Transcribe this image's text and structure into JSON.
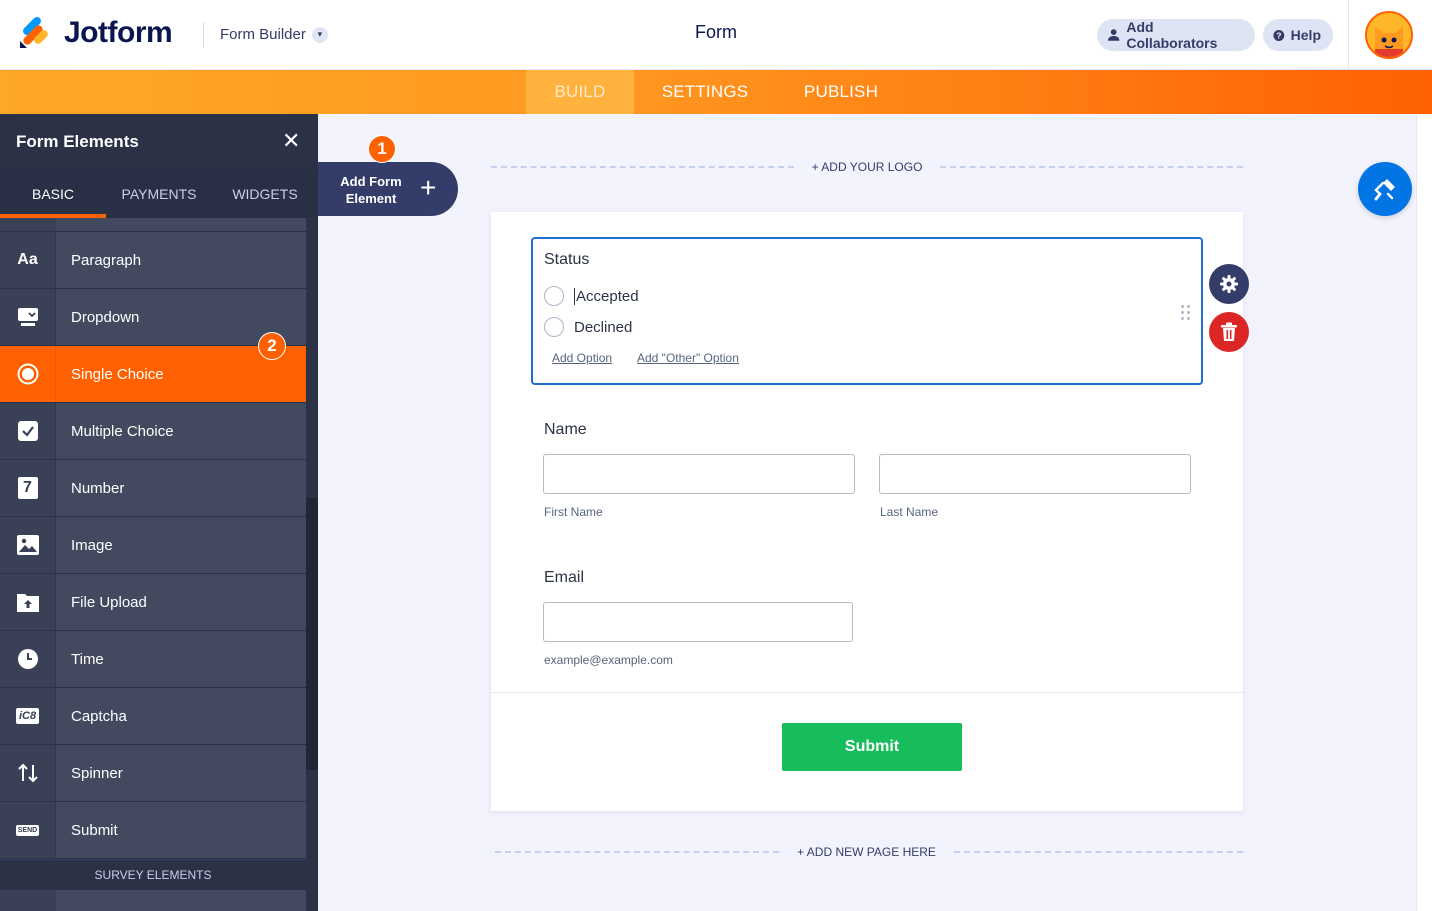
{
  "header": {
    "brand": "Jotform",
    "builder_label": "Form Builder",
    "page_title": "Form",
    "collab_label": "Add Collaborators",
    "help_label": "Help"
  },
  "nav": {
    "tabs": [
      {
        "label": "BUILD",
        "active": true
      },
      {
        "label": "SETTINGS",
        "active": false
      },
      {
        "label": "PUBLISH",
        "active": false
      }
    ]
  },
  "sidebar": {
    "title": "Form Elements",
    "close": "✕",
    "tabs": [
      {
        "label": "BASIC",
        "active": true
      },
      {
        "label": "PAYMENTS",
        "active": false
      },
      {
        "label": "WIDGETS",
        "active": false
      }
    ],
    "items": [
      {
        "label": "Paragraph",
        "icon": "paragraph-icon"
      },
      {
        "label": "Dropdown",
        "icon": "dropdown-icon"
      },
      {
        "label": "Single Choice",
        "icon": "single-choice-icon",
        "active": true
      },
      {
        "label": "Multiple Choice",
        "icon": "multiple-choice-icon"
      },
      {
        "label": "Number",
        "icon": "number-icon"
      },
      {
        "label": "Image",
        "icon": "image-icon"
      },
      {
        "label": "File Upload",
        "icon": "file-upload-icon"
      },
      {
        "label": "Time",
        "icon": "clock-icon"
      },
      {
        "label": "Captcha",
        "icon": "captcha-icon"
      },
      {
        "label": "Spinner",
        "icon": "spinner-icon"
      },
      {
        "label": "Submit",
        "icon": "send-icon"
      }
    ],
    "icon_text": {
      "paragraph": "Aa",
      "number": "7",
      "captcha": "iC8",
      "send": "SEND"
    },
    "survey_heading": "SURVEY ELEMENTS"
  },
  "badges": {
    "one": "1",
    "two": "2"
  },
  "add_element": {
    "label": "Add Form Element",
    "plus": "+"
  },
  "canvas": {
    "add_logo": "+ ADD YOUR LOGO",
    "add_page": "+ ADD NEW PAGE HERE"
  },
  "form": {
    "status": {
      "label": "Status",
      "options": [
        "Accepted",
        "Declined"
      ],
      "add_option": "Add Option",
      "add_other": "Add \"Other\" Option"
    },
    "name": {
      "label": "Name",
      "first_sub": "First Name",
      "last_sub": "Last Name"
    },
    "email": {
      "label": "Email",
      "sub": "example@example.com"
    },
    "submit_label": "Submit"
  },
  "colors": {
    "accent": "#ff6100",
    "sidebar": "#343c6a",
    "selection": "#1f6fd2",
    "submit": "#18bd5b",
    "delete": "#dc2626",
    "designer": "#0075e3"
  }
}
